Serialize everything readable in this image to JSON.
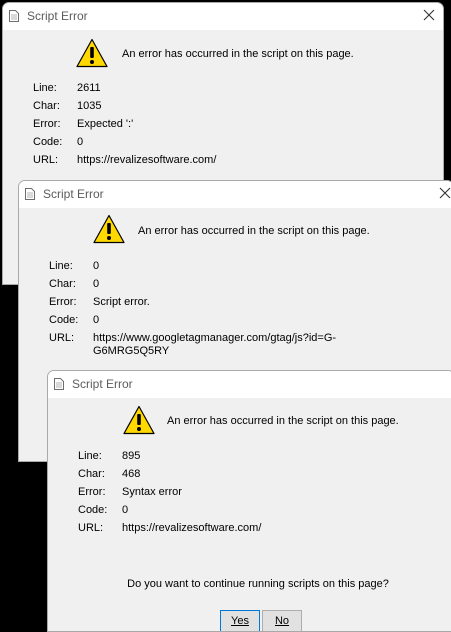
{
  "dialogs": [
    {
      "title": "Script Error",
      "message": "An error has occurred in the script on this page.",
      "labels": {
        "line": "Line:",
        "char": "Char:",
        "error": "Error:",
        "code": "Code:",
        "url": "URL:"
      },
      "line": "2611",
      "char": "1035",
      "error": "Expected ':'",
      "code": "0",
      "url": "https://revalizesoftware.com/"
    },
    {
      "title": "Script Error",
      "message": "An error has occurred in the script on this page.",
      "labels": {
        "line": "Line:",
        "char": "Char:",
        "error": "Error:",
        "code": "Code:",
        "url": "URL:"
      },
      "line": "0",
      "char": "0",
      "error": "Script error.",
      "code": "0",
      "url": "https://www.googletagmanager.com/gtag/js?id=G-G6MRG5Q5RY"
    },
    {
      "title": "Script Error",
      "message": "An error has occurred in the script on this page.",
      "labels": {
        "line": "Line:",
        "char": "Char:",
        "error": "Error:",
        "code": "Code:",
        "url": "URL:"
      },
      "line": "895",
      "char": "468",
      "error": "Syntax error",
      "code": "0",
      "url": "https://revalizesoftware.com/",
      "question": "Do you want to continue running scripts on this page?",
      "yes_label": "Yes",
      "no_label": "No"
    }
  ],
  "colors": {
    "dialog_bg": "#f0f0f0",
    "titlebar_bg": "#ffffff",
    "warning_yellow": "#ffd800",
    "focus_blue": "#0078d7"
  },
  "icons": {
    "title": "document-icon",
    "warning": "warning-icon",
    "close": "close-icon"
  }
}
